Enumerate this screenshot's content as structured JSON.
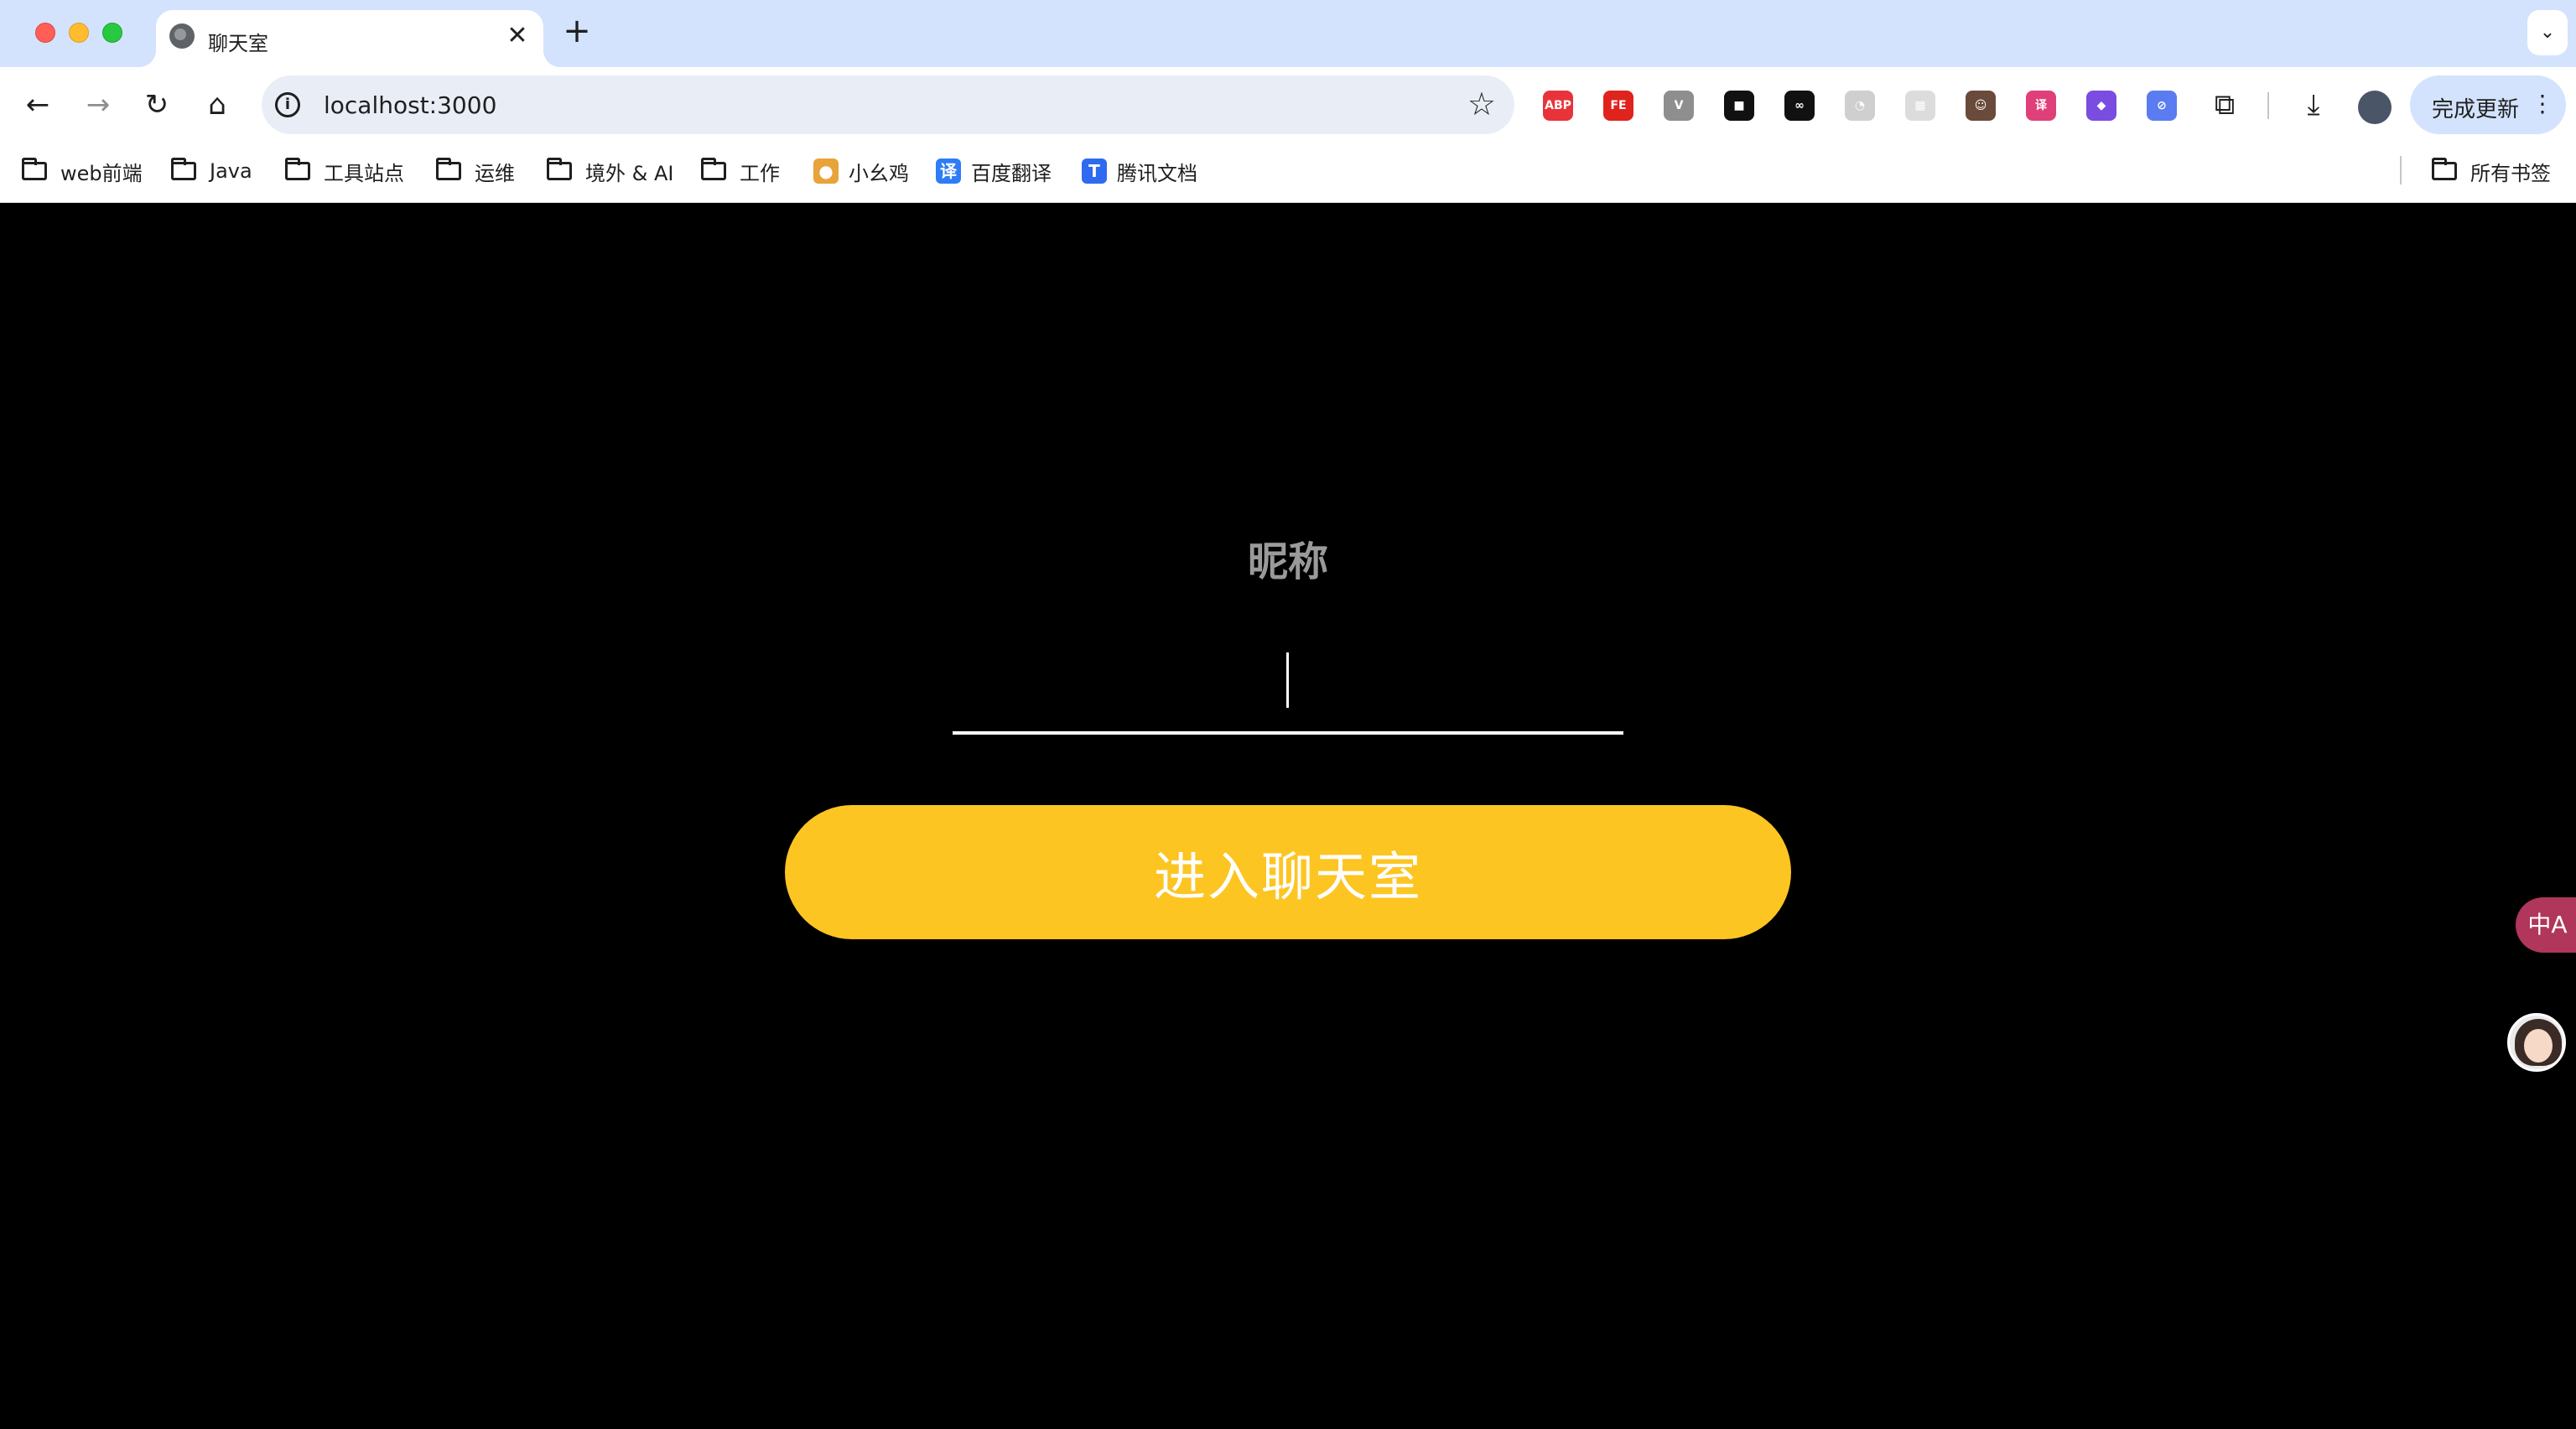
{
  "browser": {
    "tab": {
      "title": "聊天室",
      "close_glyph": "✕"
    },
    "new_tab_glyph": "+",
    "tabs_menu_glyph": "⌄",
    "nav": {
      "back": "←",
      "forward": "→",
      "reload": "↻",
      "home": "⌂"
    },
    "url": "localhost:3000",
    "info_glyph": "i",
    "star_glyph": "☆",
    "extensions": [
      {
        "name": "adblock-plus-icon",
        "label": "ABP",
        "color": "#e8333a"
      },
      {
        "name": "fe-helper-icon",
        "label": "FE",
        "color": "#e0231c"
      },
      {
        "name": "vue-devtools-icon",
        "label": "V",
        "color": "#8e8e8e"
      },
      {
        "name": "square-extension-icon",
        "label": "■",
        "color": "#111111"
      },
      {
        "name": "infinity-extension-icon",
        "label": "∞",
        "color": "#111111"
      },
      {
        "name": "timer-extension-icon",
        "label": "◔",
        "color": "#cfcfcf"
      },
      {
        "name": "grid-extension-icon",
        "label": "▦",
        "color": "#dcdcdc"
      },
      {
        "name": "avatar-extension-icon",
        "label": "☺",
        "color": "#6a4a3a"
      },
      {
        "name": "translate-extension-icon",
        "label": "译",
        "color": "#e0407a"
      },
      {
        "name": "purple-extension-icon",
        "label": "◆",
        "color": "#7b4ce0"
      },
      {
        "name": "shield-extension-icon",
        "label": "⊘",
        "color": "#5b7cf0"
      }
    ],
    "puzzle_glyph": "⧉",
    "download_glyph": "⤓",
    "update_button": {
      "label": "完成更新",
      "kebab": "⋮"
    }
  },
  "bookmarks": [
    {
      "label": "web前端",
      "kind": "folder"
    },
    {
      "label": "Java",
      "kind": "folder"
    },
    {
      "label": "工具站点",
      "kind": "folder"
    },
    {
      "label": "运维",
      "kind": "folder"
    },
    {
      "label": "境外 & AI",
      "kind": "folder"
    },
    {
      "label": "工作",
      "kind": "folder"
    },
    {
      "label": "小幺鸡",
      "kind": "site",
      "icon": "●",
      "color": "#e8a33a"
    },
    {
      "label": "百度翻译",
      "kind": "site",
      "icon": "译",
      "color": "#2e7cf6"
    },
    {
      "label": "腾讯文档",
      "kind": "site",
      "icon": "T",
      "color": "#2f6bf0"
    }
  ],
  "all_bookmarks": "所有书签",
  "login": {
    "nickname_label": "昵称",
    "nickname_value": "",
    "enter_button": "进入聊天室"
  },
  "floating": {
    "translate_glyph": "中A"
  }
}
